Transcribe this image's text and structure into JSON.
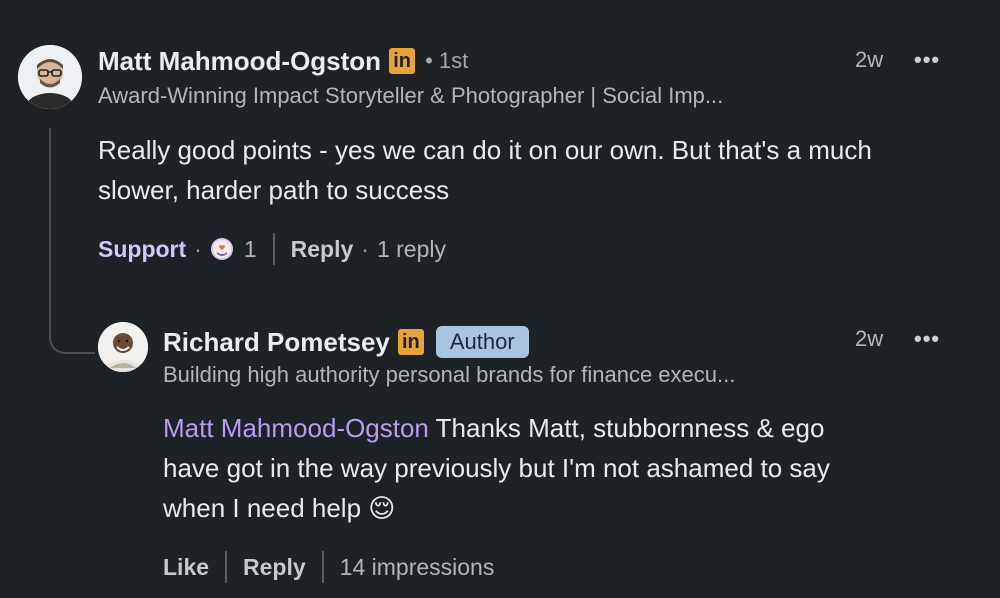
{
  "comment": {
    "author_name": "Matt Mahmood-Ogston",
    "linkedin_badge": "in",
    "degree": "• 1st",
    "headline": "Award-Winning Impact Storyteller & Photographer | Social Imp...",
    "time": "2w",
    "more_label": "•••",
    "text_line1": "Really good points - yes we can do it on our own. But that's a much",
    "text_line2": "slower, harder path to success",
    "actions": {
      "support_label": "Support",
      "reaction_count": "1",
      "reply_label": "Reply",
      "replies_count": "1 reply"
    }
  },
  "reply": {
    "author_name": "Richard Pometsey",
    "linkedin_badge": "in",
    "author_badge": "Author",
    "headline": "Building high authority personal brands for finance execu...",
    "time": "2w",
    "more_label": "•••",
    "mention": "Matt Mahmood-Ogston",
    "text_part1": " Thanks Matt, stubbornness & ego",
    "text_line2": "have got in the way previously but I'm not ashamed to say",
    "text_line3": "when I need help 😌",
    "actions": {
      "like_label": "Like",
      "reply_label": "Reply",
      "impressions": "14 impressions"
    }
  },
  "colors": {
    "background": "#1d2226",
    "mention": "#b79cf0",
    "support": "#d2c6ff",
    "linkedin_badge": "#e8a23a",
    "author_badge": "#a9c4e0"
  }
}
